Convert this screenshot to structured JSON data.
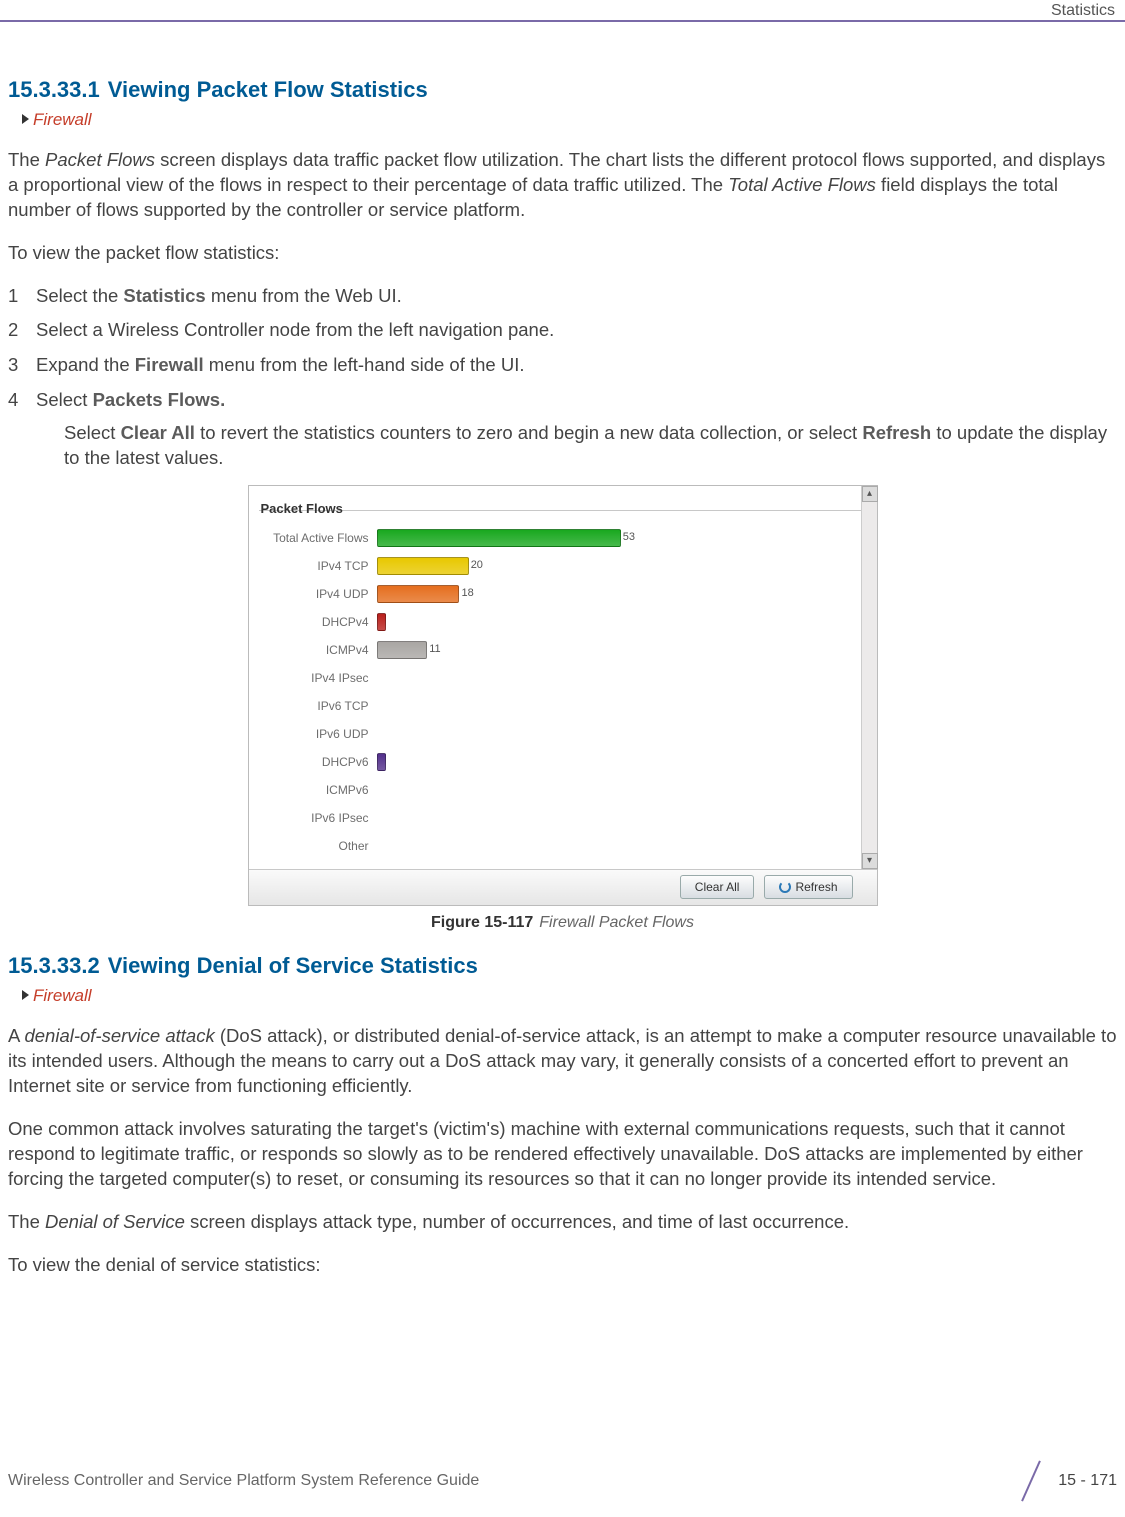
{
  "header": {
    "running_head": "Statistics"
  },
  "section1": {
    "number": "15.3.33.1",
    "title": "Viewing Packet Flow Statistics",
    "breadcrumb": "Firewall",
    "intro_pre_em1": "The ",
    "intro_em1": "Packet Flows",
    "intro_mid": " screen displays data traffic packet flow utilization. The chart lists the different protocol flows supported, and displays a proportional view of the flows in respect to their percentage of data traffic utilized. The ",
    "intro_em2": "Total Active Flows",
    "intro_post": " field displays the total number of flows supported by the controller or service platform.",
    "lead_in": "To view the packet flow statistics:",
    "steps": {
      "s1_pre": "Select the ",
      "s1_b": "Statistics",
      "s1_post": " menu from the Web UI.",
      "s2": "Select a Wireless Controller node from the left navigation pane.",
      "s3_pre": "Expand the ",
      "s3_b": "Firewall",
      "s3_post": " menu from the left-hand side of the UI.",
      "s4_pre": "Select ",
      "s4_b": "Packets Flows.",
      "sub_pre": "Select ",
      "sub_b1": "Clear All",
      "sub_mid": " to revert the statistics counters to zero and begin a new data collection, or select ",
      "sub_b2": "Refresh",
      "sub_post": " to update the display to the latest values."
    }
  },
  "figure": {
    "panel_title": "Packet Flows",
    "buttons": {
      "clear": "Clear All",
      "refresh": "Refresh"
    },
    "caption_num": "Figure 15-117",
    "caption_title": "Firewall Packet Flows"
  },
  "chart_data": {
    "type": "bar",
    "title": "Packet Flows",
    "xlabel": "",
    "ylabel": "",
    "xlim": [
      0,
      63
    ],
    "categories": [
      "Total Active Flows",
      "IPv4 TCP",
      "IPv4 UDP",
      "DHCPv4",
      "ICMPv4",
      "IPv4 IPsec",
      "IPv6 TCP",
      "IPv6 UDP",
      "DHCPv6",
      "ICMPv6",
      "IPv6 IPsec",
      "Other"
    ],
    "values": [
      53,
      20,
      18,
      2,
      11,
      0,
      0,
      0,
      2,
      0,
      0,
      0
    ],
    "colors": [
      "#19a81f",
      "#e8c800",
      "#e56e1e",
      "#b9201c",
      "#a9a6a3",
      "#a9a6a3",
      "#a9a6a3",
      "#a9a6a3",
      "#53308b",
      "#a9a6a3",
      "#a9a6a3",
      "#a9a6a3"
    ],
    "show_value": [
      true,
      true,
      true,
      false,
      true,
      false,
      false,
      false,
      false,
      false,
      false,
      false
    ]
  },
  "section2": {
    "number": "15.3.33.2",
    "title": "Viewing Denial of Service Statistics",
    "breadcrumb": "Firewall",
    "p1_pre": "A ",
    "p1_em": "denial-of-service attack",
    "p1_post": " (DoS attack), or distributed denial-of-service attack, is an attempt to make a computer resource unavailable to its intended users. Although the means to carry out a DoS attack may vary, it generally consists of a concerted effort to prevent an Internet site or service from functioning efficiently.",
    "p2": "One common attack involves saturating the target's (victim's) machine with external communications requests, such that it cannot respond to legitimate traffic, or responds so slowly as to be rendered effectively unavailable. DoS attacks are implemented by either forcing the targeted computer(s) to reset, or consuming its resources so that it can no longer provide its intended service.",
    "p3_pre": "The ",
    "p3_em": "Denial of Service",
    "p3_post": " screen displays attack type, number of occurrences, and time of last occurrence.",
    "lead_in": "To view the denial of service statistics:"
  },
  "footer": {
    "guide": "Wireless Controller and Service Platform System Reference Guide",
    "page": "15 - 171"
  }
}
